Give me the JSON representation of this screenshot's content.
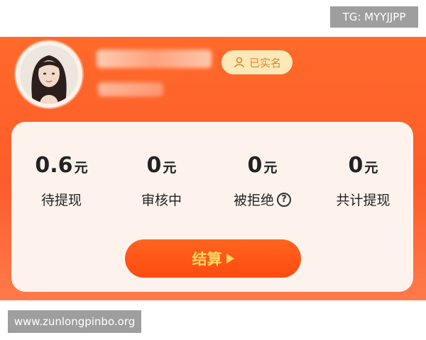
{
  "watermarks": {
    "top": "TG: MYYJJPP",
    "bottom": "www.zunlongpinbo.org"
  },
  "profile": {
    "verified_label": "已实名"
  },
  "stats": [
    {
      "value": "0.6",
      "unit": "元",
      "label": "待提现"
    },
    {
      "value": "0",
      "unit": "元",
      "label": "审核中"
    },
    {
      "value": "0",
      "unit": "元",
      "label": "被拒绝"
    },
    {
      "value": "0",
      "unit": "元",
      "label": "共计提现"
    }
  ],
  "actions": {
    "settle_label": "结算"
  },
  "icons": {
    "verified": "person-badge-icon",
    "help": "question-circle-icon",
    "settle": "play-icon"
  },
  "colors": {
    "banner": "#ff5c2b",
    "card": "#fdf3ec",
    "button": "#ff4a10",
    "button_text": "#ffd860",
    "badge_bg": "#fde9b8",
    "badge_text": "#d9852a"
  }
}
